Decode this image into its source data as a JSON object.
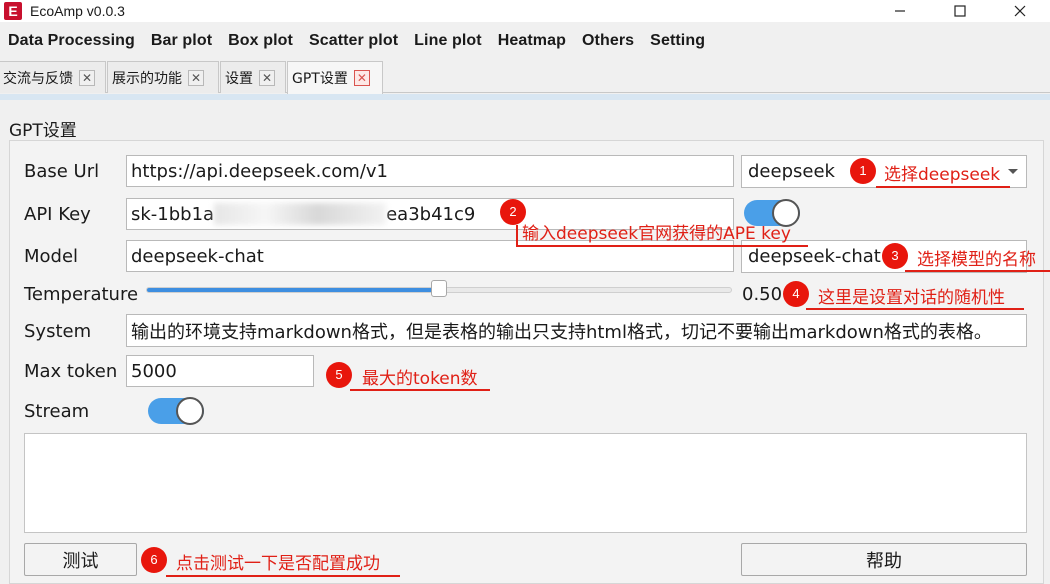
{
  "app": {
    "title": "EcoAmp v0.0.3",
    "icon_letter": "E"
  },
  "icons": [
    "app-icon",
    "minimize-icon",
    "maximize-icon",
    "close-icon",
    "chevron-down-icon",
    "tab-close-icon"
  ],
  "colors": {
    "annotation": "#e02016",
    "toggle_on": "#4a9fe8",
    "slider_fill": "#3d8ee0",
    "active_tab_close": "#d9544f"
  },
  "menu": [
    "Data Processing",
    "Bar plot",
    "Box plot",
    "Scatter plot",
    "Line plot",
    "Heatmap",
    "Others",
    "Setting"
  ],
  "tabs": [
    {
      "label": "交流与反馈",
      "active": false
    },
    {
      "label": "展示的功能",
      "active": false
    },
    {
      "label": "设置",
      "active": false
    },
    {
      "label": "GPT设置",
      "active": true
    }
  ],
  "form": {
    "group_title": "GPT设置",
    "base_url": {
      "label": "Base Url",
      "value": "https://api.deepseek.com/v1",
      "provider": "deepseek"
    },
    "api_key": {
      "label": "API Key",
      "prefix": "sk-1bb1a",
      "suffix": "ea3b41c9",
      "show_key": true
    },
    "model": {
      "label": "Model",
      "value": "deepseek-chat",
      "option": "deepseek-chat"
    },
    "temperature": {
      "label": "Temperature",
      "value": 0.5,
      "display": "0.50"
    },
    "system": {
      "label": "System",
      "value": "输出的环境支持markdown格式，但是表格的输出只支持html格式，切记不要输出markdown格式的表格。"
    },
    "max_token": {
      "label": "Max token",
      "value": "5000"
    },
    "stream": {
      "label": "Stream",
      "on": true
    },
    "output": ""
  },
  "buttons": {
    "test": "测试",
    "help": "帮助"
  },
  "annotations": [
    {
      "num": "1",
      "text": "选择deepseek"
    },
    {
      "num": "2",
      "text": "输入deepseek官网获得的APE key"
    },
    {
      "num": "3",
      "text": "选择模型的名称"
    },
    {
      "num": "4",
      "text": "这里是设置对话的随机性"
    },
    {
      "num": "5",
      "text": "最大的token数"
    },
    {
      "num": "6",
      "text": "点击测试一下是否配置成功"
    }
  ]
}
